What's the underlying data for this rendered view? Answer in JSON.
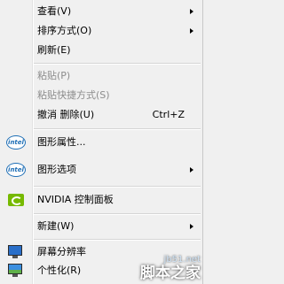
{
  "menu": {
    "view": "查看(V)",
    "sort": "排序方式(O)",
    "refresh": "刷新(E)",
    "paste": "粘贴(P)",
    "paste_shortcut": "粘贴快捷方式(S)",
    "undo_delete": "撤消 删除(U)",
    "undo_shortcut": "Ctrl+Z",
    "graphics_properties": "图形属性...",
    "graphics_options": "图形选项",
    "nvidia": "NVIDIA 控制面板",
    "new": "新建(W)",
    "screen_resolution": "屏幕分辨率",
    "personalize": "个性化(R)"
  },
  "icons": {
    "intel_text": "intel"
  },
  "watermark": {
    "site": "jb51.net",
    "name": "脚本之家"
  }
}
